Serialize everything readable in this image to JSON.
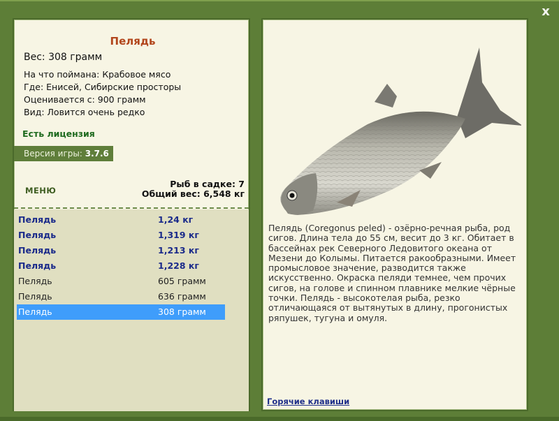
{
  "window": {
    "close_label": "x"
  },
  "fish": {
    "name": "Пелядь",
    "weight_line": "Вес: 308 грамм",
    "details": [
      "На что поймана: Крабовое мясо",
      "Где: Енисей, Сибирские просторы",
      "Оценивается с: 900 грамм",
      "Вид: Ловится очень редко"
    ],
    "description": "Пелядь (Coregonus peled) - озёрно-речная рыба, род сигов. Длина тела до 55 см, весит до 3 кг. Обитает в бассейнах рек Северного Ледовитого океана от Мезени до Колымы. Питается ракообразными. Имеет промысловое значение, разводится также искусственно. Окраска пеляди темнее, чем прочих сигов, на голове и спинном плавнике мелкие чёрные точки. Пелядь - высокотелая рыба, резко отличающаяся от вытянутых в длину, прогонистых ряпушек, тугуна и омуля."
  },
  "license": "Есть лицензия",
  "version": {
    "label": "Версия игры:",
    "number": "3.7.6"
  },
  "menu_label": "МЕНЮ",
  "keepnet": {
    "count_line": "Рыб в садке: 7",
    "total_line": "Общий вес: 6,548 кг"
  },
  "catch_list": [
    {
      "name": "Пелядь",
      "weight": "1,24 кг",
      "style": "big"
    },
    {
      "name": "Пелядь",
      "weight": "1,319 кг",
      "style": "big"
    },
    {
      "name": "Пелядь",
      "weight": "1,213 кг",
      "style": "big"
    },
    {
      "name": "Пелядь",
      "weight": "1,228 кг",
      "style": "big"
    },
    {
      "name": "Пелядь",
      "weight": "605 грамм",
      "style": "small"
    },
    {
      "name": "Пелядь",
      "weight": "636 грамм",
      "style": "small"
    },
    {
      "name": "Пелядь",
      "weight": "308 грамм",
      "style": "selected"
    }
  ],
  "hotkeys_label": "Горячие клавиши"
}
